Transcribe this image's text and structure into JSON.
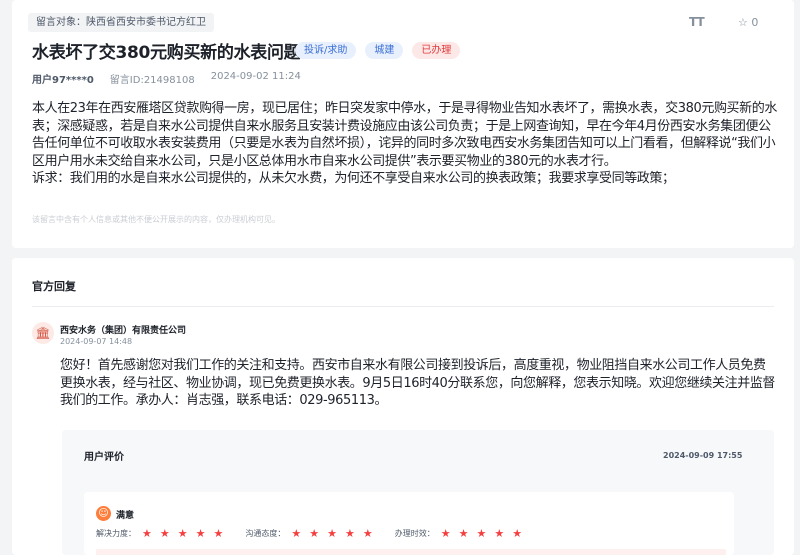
{
  "message": {
    "target_label": "留言对象：陕西省西安市委书记方红卫",
    "font_toggle": "TT",
    "star_icon": "☆",
    "star_count": "0",
    "title": "水表坏了交380元购买新的水表问题",
    "tags": [
      {
        "label": "投诉/求助",
        "color": "blue"
      },
      {
        "label": "城建",
        "color": "blue"
      },
      {
        "label": "已办理",
        "color": "red"
      }
    ],
    "user": "用户97****0",
    "message_id": "留言ID:21498108",
    "datetime": "2024-09-02 11:24",
    "body": [
      "本人在23年在西安雁塔区贷款购得一房，现已居住；昨日突发家中停水，于是寻得物业告知水表坏了，需换水表，交380元购买新的水表；深感疑惑，若是自来水公司提供自来水服务且安装计费设施应由该公司负责；于是上网查询知，早在今年4月份西安水务集团便公告任何单位不可收取水表安装费用（只要是水表为自然坏损），诧异的同时多次致电西安水务集团告知可以上门看看，但解释说“我们小区用户用水未交给自来水公司，只是小区总体用水市自来水公司提供”表示要买物业的380元的水表才行。",
      "诉求：我们用的水是自来水公司提供的，从未欠水费，为何还不享受自来水公司的换表政策；我要求享受同等政策；"
    ],
    "note": "该留言中含有个人信息或其他不便公开展示的内容，仅办理机构可见。"
  },
  "reply": {
    "section_title": "官方回复",
    "org_icon": "🏛",
    "org_name": "西安水务（集团）有限责任公司",
    "date": "2024-09-07 14:48",
    "text": "您好！首先感谢您对我们工作的关注和支持。西安市自来水有限公司接到投诉后，高度重视，物业阻挡自来水公司工作人员免费更换水表，经与社区、物业协调，现已免费更换水表。9月5日16时40分联系您，向您解释，您表示知晓。欢迎您继续关注并监督我们的工作。承办人：肖志强，联系电话：029-965113。"
  },
  "evaluation": {
    "title": "用户评价",
    "date": "2024-09-09 17:55",
    "face_icon": "☺",
    "satisfaction": "满意",
    "star_glyph": "★",
    "ratings": [
      {
        "label": "解决力度：",
        "stars": 5
      },
      {
        "label": "沟通态度：",
        "stars": 5
      },
      {
        "label": "办理时效：",
        "stars": 5
      }
    ],
    "star_color": "#f53f3f"
  }
}
